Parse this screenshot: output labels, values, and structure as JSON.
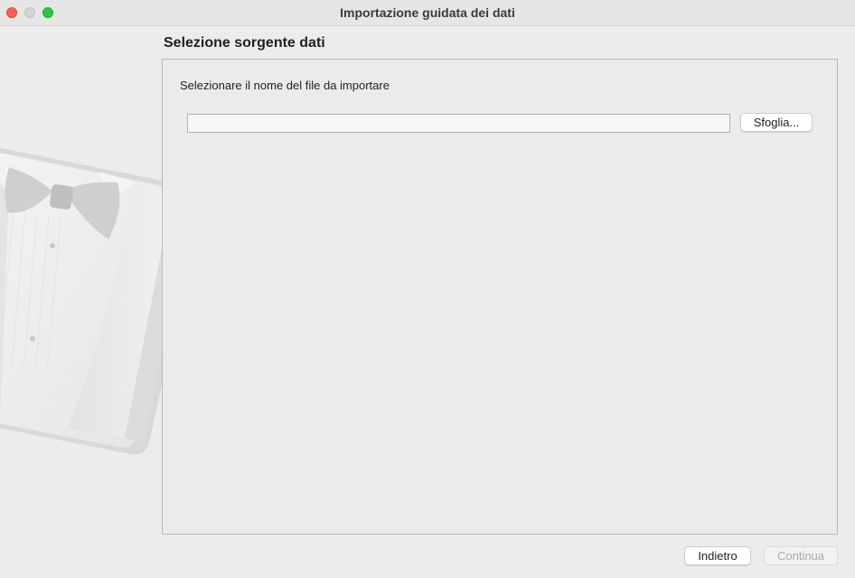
{
  "window": {
    "title": "Importazione guidata dei dati"
  },
  "wizard": {
    "step_title": "Selezione sorgente dati",
    "prompt": "Selezionare il nome del file da importare",
    "file_input": {
      "value": "",
      "placeholder": ""
    },
    "browse_label": "Sfoglia...",
    "back_label": "Indietro",
    "continue_label": "Continua",
    "continue_enabled": false
  },
  "colors": {
    "close": "#fe5f57",
    "minimize_inactive": "#d4d4d4",
    "zoom": "#2ac840",
    "window_background": "#ececec",
    "disabled_text": "#ababab"
  },
  "icons": {
    "wizard_art": "tuxedo-butler-icon"
  }
}
